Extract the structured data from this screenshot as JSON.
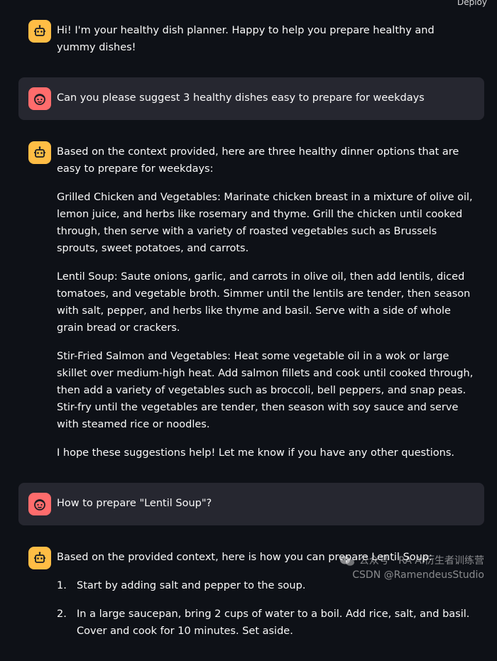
{
  "header": {
    "deploy_label": "Deploy"
  },
  "messages": [
    {
      "role": "assistant",
      "paragraphs": [
        "Hi! I'm your healthy dish planner. Happy to help you prepare healthy and yummy dishes!"
      ]
    },
    {
      "role": "user",
      "paragraphs": [
        "Can you please suggest 3 healthy dishes easy to prepare for weekdays"
      ]
    },
    {
      "role": "assistant",
      "paragraphs": [
        "Based on the context provided, here are three healthy dinner options that are easy to prepare for weekdays:",
        "Grilled Chicken and Vegetables: Marinate chicken breast in a mixture of olive oil, lemon juice, and herbs like rosemary and thyme. Grill the chicken until cooked through, then serve with a variety of roasted vegetables such as Brussels sprouts, sweet potatoes, and carrots.",
        "Lentil Soup: Saute onions, garlic, and carrots in olive oil, then add lentils, diced tomatoes, and vegetable broth. Simmer until the lentils are tender, then season with salt, pepper, and herbs like thyme and basil. Serve with a side of whole grain bread or crackers.",
        "Stir-Fried Salmon and Vegetables: Heat some vegetable oil in a wok or large skillet over medium-high heat. Add salmon fillets and cook until cooked through, then add a variety of vegetables such as broccoli, bell peppers, and snap peas. Stir-fry until the vegetables are tender, then season with soy sauce and serve with steamed rice or noodles.",
        "I hope these suggestions help! Let me know if you have any other questions."
      ]
    },
    {
      "role": "user",
      "paragraphs": [
        "How to prepare \"Lentil Soup\"?"
      ]
    },
    {
      "role": "assistant",
      "paragraphs": [
        "Based on the provided context, here is how you can prepare Lentil Soup:"
      ],
      "steps": [
        {
          "num": "1.",
          "text": "Start by adding salt and pepper to the soup."
        },
        {
          "num": "2.",
          "text": "In a large saucepan, bring 2 cups of water to a boil. Add rice, salt, and basil. Cover and cook for 10 minutes. Set aside."
        }
      ]
    }
  ],
  "watermark": {
    "line1": "公众号 · RA AI衍生者训练营",
    "line2": "CSDN @RamendeusStudio"
  },
  "colors": {
    "background": "#0e1117",
    "user_bubble": "#262730",
    "assistant_avatar": "#ffbd45",
    "user_avatar": "#ff6c6c",
    "text": "#fafafa"
  },
  "icons": {
    "assistant_avatar": "robot-icon",
    "user_avatar": "smiley-face-icon",
    "watermark": "wechat-icon"
  }
}
